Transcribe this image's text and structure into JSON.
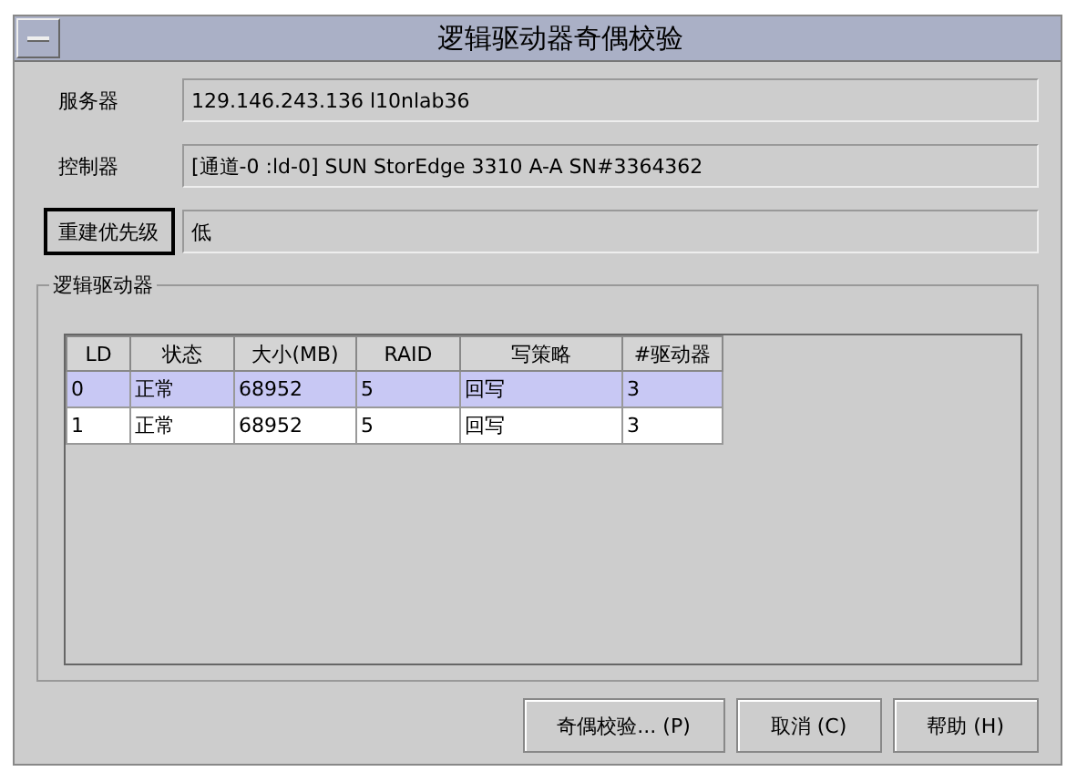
{
  "window": {
    "title": "逻辑驱动器奇偶校验"
  },
  "fields": [
    {
      "label": "服务器",
      "value": "129.146.243.136 l10nlab36",
      "focused": false
    },
    {
      "label": "控制器",
      "value": "[通道-0 :ld-0] SUN StorEdge 3310 A-A SN#3364362",
      "focused": false
    },
    {
      "label": "重建优先级",
      "value": "低",
      "focused": true
    }
  ],
  "group": {
    "title": "逻辑驱动器"
  },
  "table": {
    "columns": [
      "LD",
      "状态",
      "大小(MB)",
      "RAID",
      "写策略",
      "#驱动器"
    ],
    "rows": [
      {
        "cells": [
          "0",
          "正常",
          "68952",
          "5",
          "回写",
          "3"
        ],
        "selected": true
      },
      {
        "cells": [
          "1",
          "正常",
          "68952",
          "5",
          "回写",
          "3"
        ],
        "selected": false
      }
    ]
  },
  "buttons": [
    "奇偶校验... (P)",
    "取消 (C)",
    "帮助 (H)"
  ]
}
